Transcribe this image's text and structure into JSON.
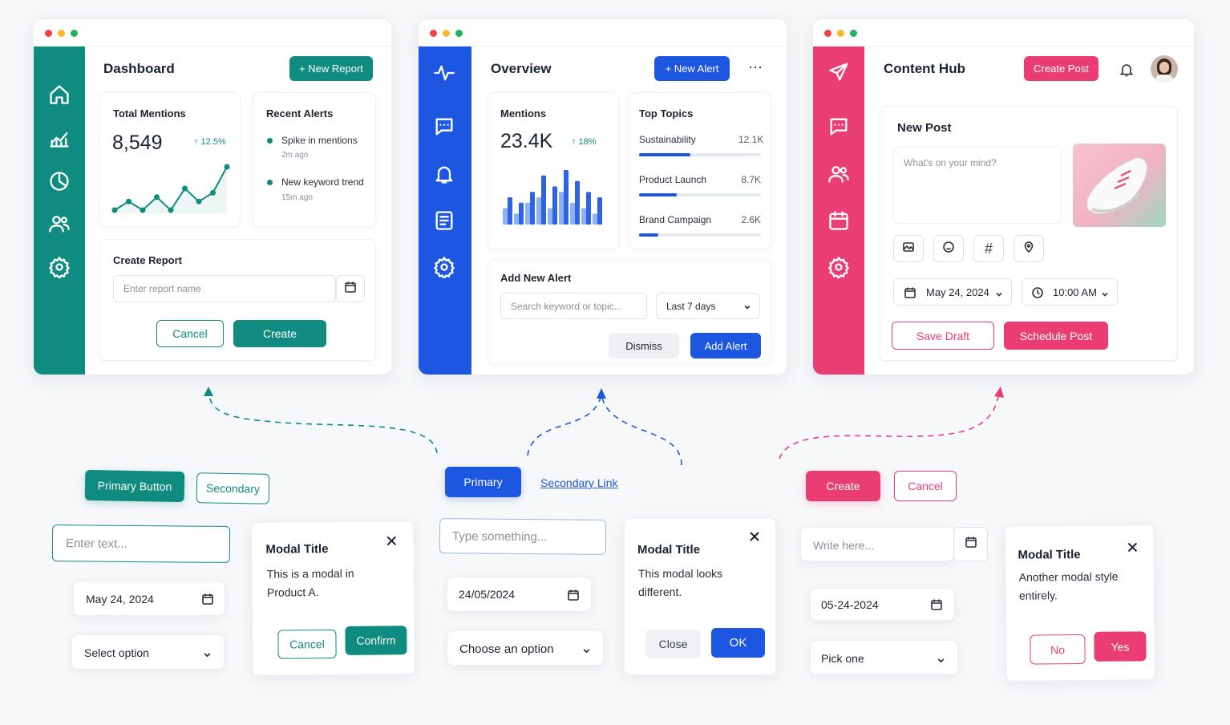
{
  "colors": {
    "teal": "#0f8b80",
    "blue": "#1d56e0",
    "pink": "#ea3d74",
    "dot_red": "#ef4444",
    "dot_yellow": "#f5b82e",
    "dot_green": "#22b35e"
  },
  "dashboard": {
    "title": "Dashboard",
    "new_report": "+ New Report",
    "mentions": {
      "label": "Total Mentions",
      "value": "8,549",
      "change": "↑ 12.5%"
    },
    "sparkline": [
      3,
      5,
      3,
      6,
      3,
      8,
      5,
      7,
      13
    ],
    "alerts": {
      "label": "Recent Alerts",
      "items": [
        {
          "text": "Spike in mentions",
          "time": "2m ago"
        },
        {
          "text": "New keyword trend",
          "time": "15m ago"
        }
      ]
    },
    "create": {
      "label": "Create Report",
      "placeholder": "Enter report name",
      "cancel": "Cancel",
      "create": "Create"
    },
    "sidebar": [
      "home-icon",
      "chart-icon",
      "pie-icon",
      "users-icon",
      "settings-icon"
    ]
  },
  "overview": {
    "title": "Overview",
    "new_alert": "+ New Alert",
    "more": "⋯",
    "mentions": {
      "label": "Mentions",
      "value": "23.4K",
      "change": "↑ 18%"
    },
    "bars": [
      [
        3,
        5
      ],
      [
        2,
        4
      ],
      [
        4,
        6
      ],
      [
        5,
        9
      ],
      [
        3,
        7
      ],
      [
        6,
        10
      ],
      [
        4,
        8
      ],
      [
        3,
        6
      ],
      [
        2,
        5
      ]
    ],
    "topics": {
      "label": "Top Topics",
      "items": [
        {
          "name": "Sustainability",
          "value": "12.1K",
          "pct": 0.42
        },
        {
          "name": "Product Launch",
          "value": "8.7K",
          "pct": 0.31
        },
        {
          "name": "Brand Campaign",
          "value": "2.6K",
          "pct": 0.16
        }
      ]
    },
    "add": {
      "label": "Add New Alert",
      "placeholder": "Search keyword or topic...",
      "range": "Last 7 days",
      "dismiss": "Dismiss",
      "add": "Add Alert"
    }
  },
  "hub": {
    "title": "Content Hub",
    "create_post": "Create Post",
    "post": {
      "label": "New Post",
      "placeholder": "What's on your mind?",
      "hash": "#",
      "date": "May 24, 2024",
      "time": "10:00 AM",
      "save": "Save Draft",
      "schedule": "Schedule Post"
    }
  },
  "teal_kit": {
    "primary": "Primary Button",
    "secondary": "Secondary",
    "input_placeholder": "Enter text...",
    "date": "May 24, 2024",
    "select": "Select option",
    "modal": {
      "title": "Modal Title",
      "body": "This is a modal in Product A.",
      "cancel": "Cancel",
      "confirm": "Confirm"
    }
  },
  "blue_kit": {
    "primary": "Primary",
    "link": "Secondary Link",
    "input_placeholder": "Type something...",
    "date": "24/05/2024",
    "select": "Choose an option",
    "modal": {
      "title": "Modal Title",
      "body": "This modal looks different.",
      "close": "Close",
      "ok": "OK"
    }
  },
  "pink_kit": {
    "create": "Create",
    "cancel": "Cancel",
    "input_placeholder": "Write here...",
    "date": "05-24-2024",
    "select": "Pick one",
    "modal": {
      "title": "Modal Title",
      "body": "Another modal style entirely.",
      "no": "No",
      "yes": "Yes"
    }
  }
}
